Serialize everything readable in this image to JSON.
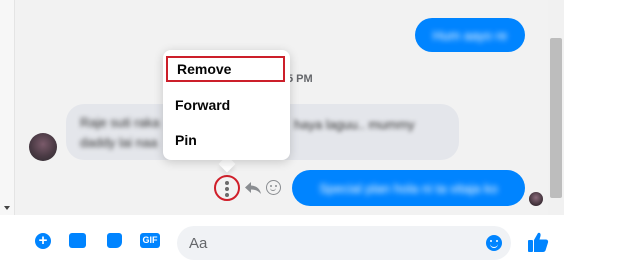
{
  "conversation": {
    "timestamp_fragment": "5 PM",
    "outgoing_messages": [
      "Hum aayo re",
      "Special plan hola ni ta vitaja ko"
    ],
    "incoming_message": {
      "line1": "Raje suti raka",
      "line1_tail": "haya laguu.. mummy",
      "line2": "daddy lai naa"
    }
  },
  "context_menu": {
    "items": [
      "Remove",
      "Forward",
      "Pin"
    ]
  },
  "composer": {
    "placeholder": "Aa",
    "gif_label": "GIF",
    "plus_label": "+"
  },
  "colors": {
    "accent": "#0084ff",
    "highlight": "#cc1f2a",
    "incoming_bubble": "#e4e6eb",
    "chat_background": "#f2f2f2"
  },
  "icons": [
    "plus-icon",
    "image-icon",
    "sticker-icon",
    "gif-icon",
    "emoji-icon",
    "like-icon",
    "more-icon",
    "reply-icon",
    "react-icon"
  ]
}
